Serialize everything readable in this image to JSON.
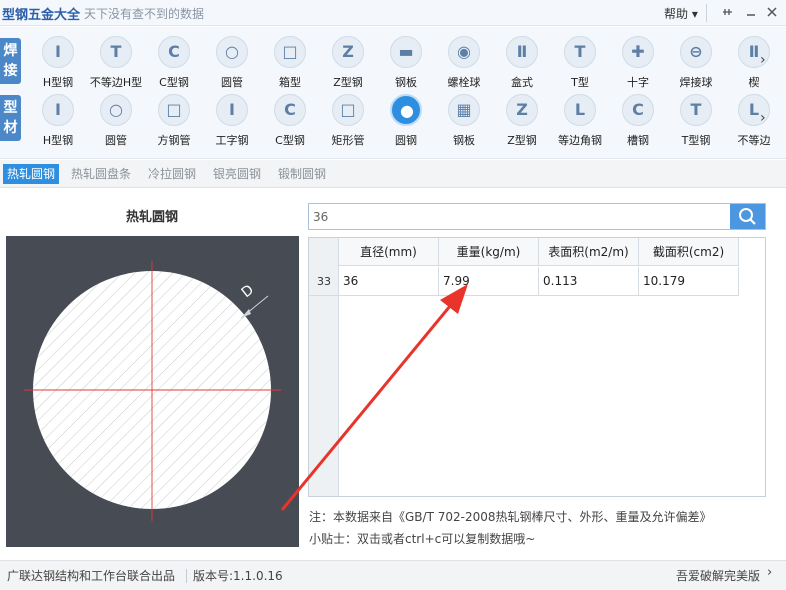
{
  "window": {
    "title": "型钢五金大全",
    "subtitle": "天下没有查不到的数据",
    "help_label": "帮助",
    "help_arrow": "▾"
  },
  "toolbar": {
    "row1": {
      "category": "焊接",
      "items": [
        {
          "label": "H型钢",
          "glyph": "I"
        },
        {
          "label": "不等边H型",
          "glyph": "T"
        },
        {
          "label": "C型钢",
          "glyph": "C"
        },
        {
          "label": "圆管",
          "glyph": "○"
        },
        {
          "label": "箱型",
          "glyph": "□"
        },
        {
          "label": "Z型钢",
          "glyph": "Z"
        },
        {
          "label": "钢板",
          "glyph": "▬"
        },
        {
          "label": "螺栓球",
          "glyph": "◉"
        },
        {
          "label": "盒式",
          "glyph": "Ⅱ"
        },
        {
          "label": "T型",
          "glyph": "T"
        },
        {
          "label": "十字",
          "glyph": "✚"
        },
        {
          "label": "焊接球",
          "glyph": "⊖"
        },
        {
          "label": "楔",
          "glyph": "Ⅱ"
        }
      ]
    },
    "row2": {
      "category": "型材",
      "items": [
        {
          "label": "H型钢",
          "glyph": "I"
        },
        {
          "label": "圆管",
          "glyph": "○"
        },
        {
          "label": "方钢管",
          "glyph": "□"
        },
        {
          "label": "工字钢",
          "glyph": "I"
        },
        {
          "label": "C型钢",
          "glyph": "C"
        },
        {
          "label": "矩形管",
          "glyph": "□"
        },
        {
          "label": "圆钢",
          "glyph": "●"
        },
        {
          "label": "钢板",
          "glyph": "▦"
        },
        {
          "label": "Z型钢",
          "glyph": "Z"
        },
        {
          "label": "等边角钢",
          "glyph": "L"
        },
        {
          "label": "槽钢",
          "glyph": "C"
        },
        {
          "label": "T型钢",
          "glyph": "T"
        },
        {
          "label": "不等边",
          "glyph": "L"
        }
      ]
    }
  },
  "subtabs": [
    "热轧圆钢",
    "热轧圆盘条",
    "冷拉圆钢",
    "银亮圆钢",
    "锻制圆钢"
  ],
  "diagram": {
    "title": "热轧圆钢",
    "dimension_label": "D"
  },
  "search": {
    "value": "36",
    "icon": "search-icon"
  },
  "table": {
    "headers": [
      "直径(mm)",
      "重量(kg/m)",
      "表面积(m2/m)",
      "截面积(cm2)"
    ],
    "rows": [
      {
        "index": "33",
        "cells": [
          "36",
          "7.99",
          "0.113",
          "10.179"
        ]
      }
    ]
  },
  "notes": {
    "source": "注：本数据来自《GB/T 702-2008热轧钢棒尺寸、外形、重量及允许偏差》",
    "tip": "小贴士：双击或者ctrl+c可以复制数据哦~"
  },
  "status": {
    "credit": "广联达钢结构和工作台联合出品",
    "version": "版本号:1.1.0.16",
    "right": "吾爱破解完美版"
  },
  "colors": {
    "accent": "#2e8fe0",
    "arrow": "#e8342a",
    "drawing_bg": "#474b53"
  }
}
